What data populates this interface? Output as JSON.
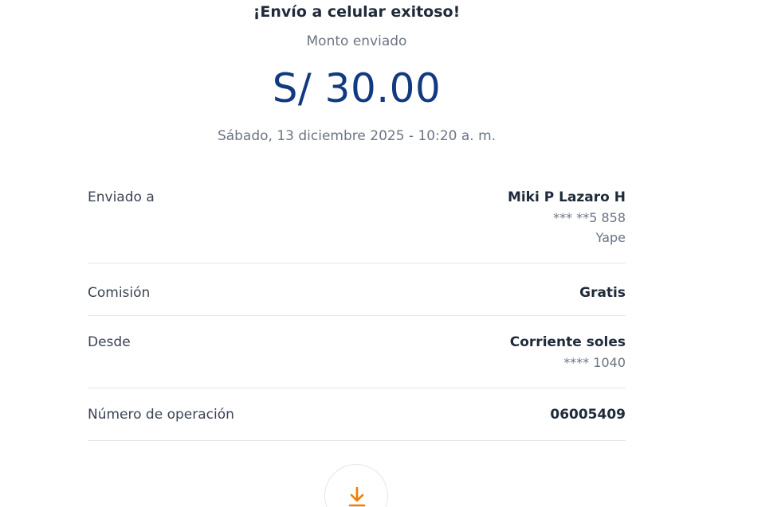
{
  "header": {
    "title": "¡Envío a celular exitoso!",
    "amount_label": "Monto enviado",
    "amount": "S/ 30.00",
    "datetime": "Sábado, 13 diciembre 2025 - 10:20 a. m."
  },
  "details": {
    "sent_to": {
      "label": "Enviado a",
      "name": "Miki P Lazaro H",
      "phone": "*** **5 858",
      "app": "Yape"
    },
    "commission": {
      "label": "Comisión",
      "value": "Gratis"
    },
    "from": {
      "label": "Desde",
      "account": "Corriente soles",
      "number": "**** 1040"
    },
    "operation": {
      "label": "Número de operación",
      "value": "06005409"
    }
  },
  "download": {
    "icon": "download-icon",
    "color": "#f07d00"
  },
  "colors": {
    "amount": "#123a80",
    "accent": "#f07d00"
  }
}
